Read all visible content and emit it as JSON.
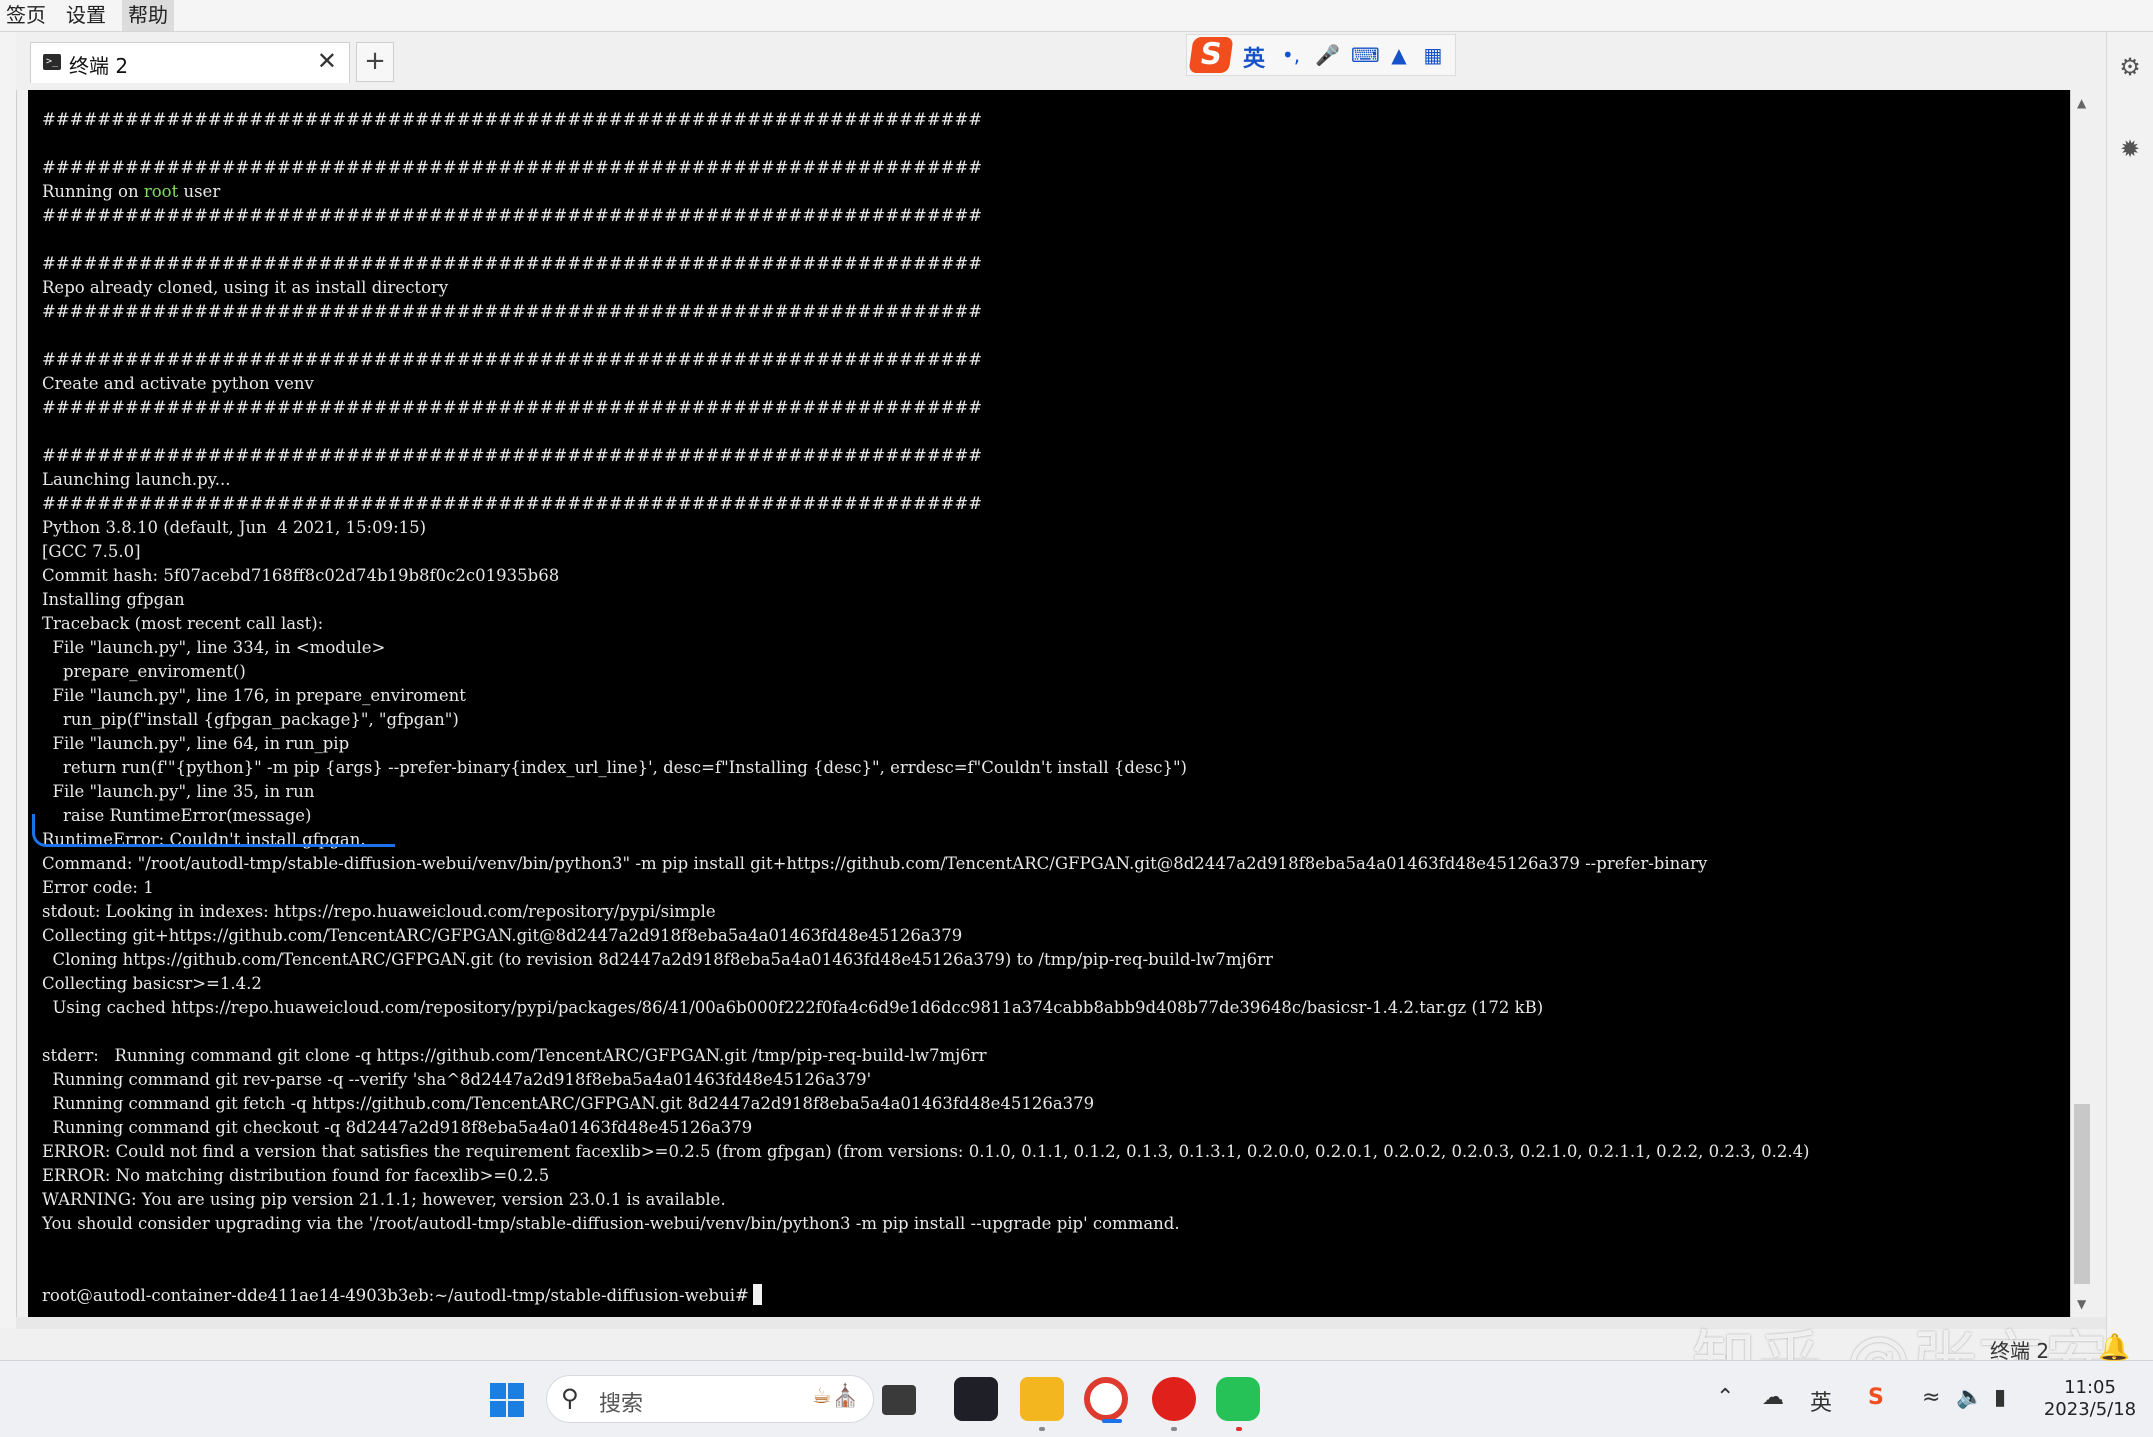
{
  "menubar": {
    "items": [
      "签页",
      "设置",
      "帮助"
    ]
  },
  "tab": {
    "title": "终端 2",
    "close": "✕",
    "add": "+"
  },
  "ime": {
    "logo": "S",
    "lang": "英"
  },
  "terminal": {
    "lines": [
      "####################################################################",
      "",
      "####################################################################",
      "Running on root user",
      "####################################################################",
      "",
      "####################################################################",
      "Repo already cloned, using it as install directory",
      "####################################################################",
      "",
      "####################################################################",
      "Create and activate python venv",
      "####################################################################",
      "",
      "####################################################################",
      "Launching launch.py...",
      "####################################################################",
      "Python 3.8.10 (default, Jun  4 2021, 15:09:15)",
      "[GCC 7.5.0]",
      "Commit hash: 5f07acebd7168ff8c02d74b19b8f0c2c01935b68",
      "Installing gfpgan",
      "Traceback (most recent call last):",
      "  File \"launch.py\", line 334, in <module>",
      "    prepare_enviroment()",
      "  File \"launch.py\", line 176, in prepare_enviroment",
      "    run_pip(f\"install {gfpgan_package}\", \"gfpgan\")",
      "  File \"launch.py\", line 64, in run_pip",
      "    return run(f'\"{python}\" -m pip {args} --prefer-binary{index_url_line}', desc=f\"Installing {desc}\", errdesc=f\"Couldn't install {desc}\")",
      "  File \"launch.py\", line 35, in run",
      "    raise RuntimeError(message)",
      "RuntimeError: Couldn't install gfpgan.",
      "Command: \"/root/autodl-tmp/stable-diffusion-webui/venv/bin/python3\" -m pip install git+https://github.com/TencentARC/GFPGAN.git@8d2447a2d918f8eba5a4a01463fd48e45126a379 --prefer-binary",
      "Error code: 1",
      "stdout: Looking in indexes: https://repo.huaweicloud.com/repository/pypi/simple",
      "Collecting git+https://github.com/TencentARC/GFPGAN.git@8d2447a2d918f8eba5a4a01463fd48e45126a379",
      "  Cloning https://github.com/TencentARC/GFPGAN.git (to revision 8d2447a2d918f8eba5a4a01463fd48e45126a379) to /tmp/pip-req-build-lw7mj6rr",
      "Collecting basicsr>=1.4.2",
      "  Using cached https://repo.huaweicloud.com/repository/pypi/packages/86/41/00a6b000f222f0fa4c6d9e1d6dcc9811a374cabb8abb9d408b77de39648c/basicsr-1.4.2.tar.gz (172 kB)",
      "",
      "stderr:   Running command git clone -q https://github.com/TencentARC/GFPGAN.git /tmp/pip-req-build-lw7mj6rr",
      "  Running command git rev-parse -q --verify 'sha^8d2447a2d918f8eba5a4a01463fd48e45126a379'",
      "  Running command git fetch -q https://github.com/TencentARC/GFPGAN.git 8d2447a2d918f8eba5a4a01463fd48e45126a379",
      "  Running command git checkout -q 8d2447a2d918f8eba5a4a01463fd48e45126a379",
      "ERROR: Could not find a version that satisfies the requirement facexlib>=0.2.5 (from gfpgan) (from versions: 0.1.0, 0.1.1, 0.1.2, 0.1.3, 0.1.3.1, 0.2.0.0, 0.2.0.1, 0.2.0.2, 0.2.0.3, 0.2.1.0, 0.2.1.1, 0.2.2, 0.2.3, 0.2.4)",
      "ERROR: No matching distribution found for facexlib>=0.2.5",
      "WARNING: You are using pip version 21.1.1; however, version 23.0.1 is available.",
      "You should consider upgrading via the '/root/autodl-tmp/stable-diffusion-webui/venv/bin/python3 -m pip install --upgrade pip' command.",
      "",
      ""
    ],
    "prompt": "root@autodl-container-dde411ae14-4903b3eb:~/autodl-tmp/stable-diffusion-webui#",
    "highlight_word": "root",
    "highlight_color": "#7fe05a"
  },
  "watermark": "知乎 @张文安",
  "taskbar": {
    "search_placeholder": "搜索",
    "notif_label": "终端 2",
    "time": "11:05",
    "date": "2023/5/18",
    "tray_lang": "英"
  }
}
